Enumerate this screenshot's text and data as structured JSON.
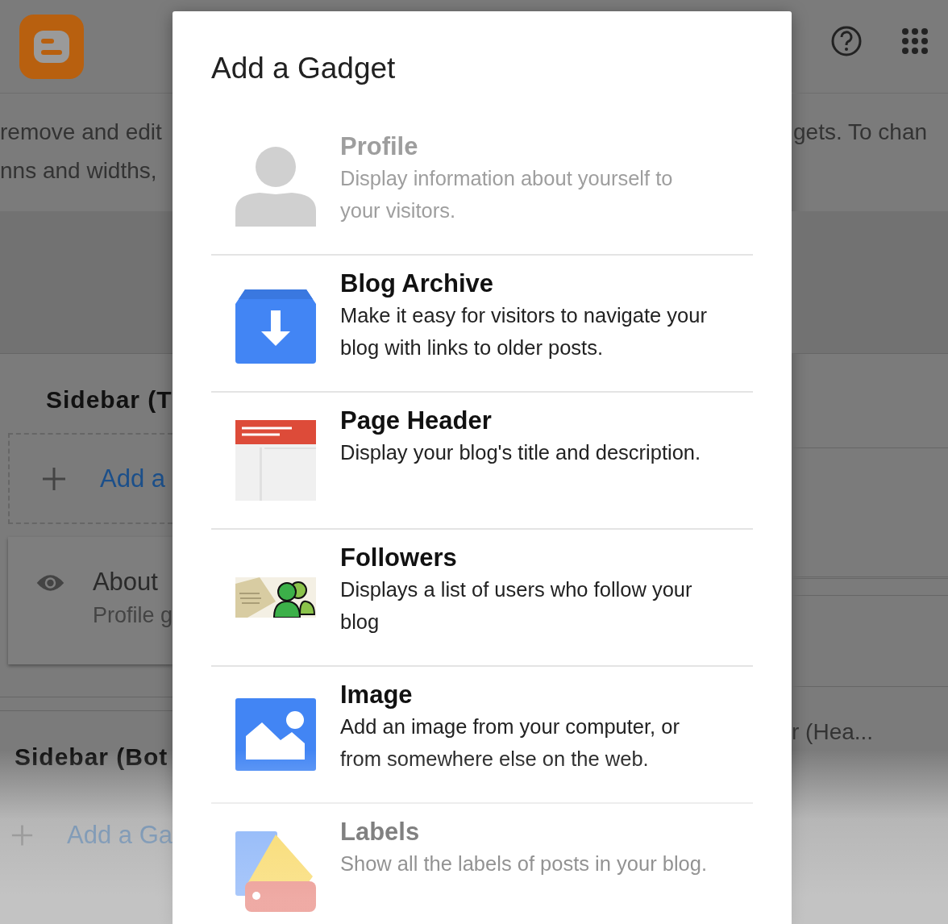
{
  "background": {
    "intro_lines": [
      "remove and edit",
      "nns and widths,"
    ],
    "intro_right": "gets. To chan",
    "sections": [
      {
        "title": "Sidebar (T",
        "add_label": "Add a",
        "gadgets": [
          {
            "title": "About",
            "subtitle": "Profile g"
          }
        ]
      },
      {
        "title": "Sidebar (Bot",
        "add_label": "Add a Ga"
      }
    ],
    "right_label": "r (Hea..."
  },
  "dialog": {
    "title": "Add a Gadget",
    "items": [
      {
        "kind": "profile",
        "title": "Profile",
        "description": "Display information about yourself to your visitors.",
        "disabled": true
      },
      {
        "kind": "archive",
        "title": "Blog Archive",
        "description": "Make it easy for visitors to navigate your blog with links to older posts.",
        "disabled": false
      },
      {
        "kind": "header",
        "title": "Page Header",
        "description": "Display your blog's title and description.",
        "disabled": false
      },
      {
        "kind": "followers",
        "title": "Followers",
        "description": "Displays a list of users who follow your blog",
        "disabled": false
      },
      {
        "kind": "image",
        "title": "Image",
        "description": "Add an image from your computer, or from somewhere else on the web.",
        "disabled": false
      },
      {
        "kind": "labels",
        "title": "Labels",
        "description": "Show all the labels of posts in your blog.",
        "disabled": false
      }
    ]
  }
}
